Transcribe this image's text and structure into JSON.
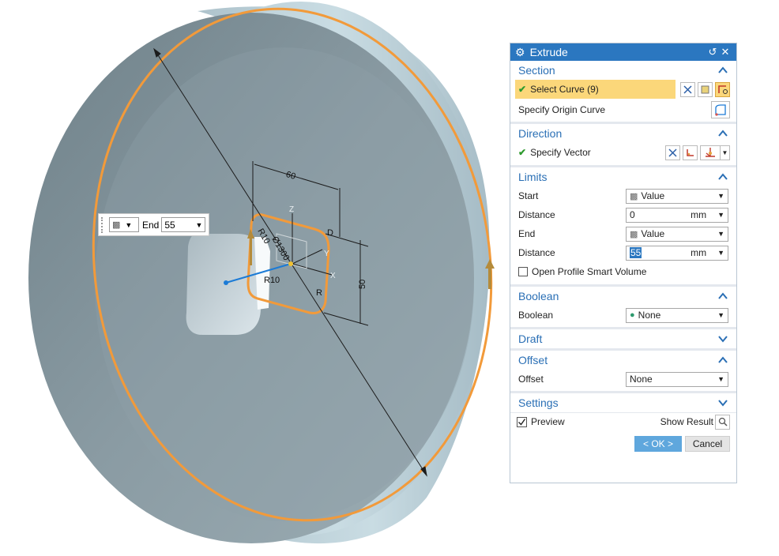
{
  "viewport": {
    "dim_60": "60",
    "dim_50": "50",
    "dim_r10_a": "R10",
    "dim_dia": "Ø1300",
    "dim_r10_b": "R10",
    "dim_r_c": "R",
    "dim_d": "D",
    "axis_z": "Z",
    "axis_y": "Y",
    "axis_x": "X"
  },
  "onscreen": {
    "end_label": "End",
    "end_value": "55"
  },
  "dialog": {
    "title": "Extrude",
    "section": {
      "header": "Section",
      "select_curve": "Select Curve (9)",
      "specify_origin": "Specify Origin Curve"
    },
    "direction": {
      "header": "Direction",
      "specify_vector": "Specify Vector"
    },
    "limits": {
      "header": "Limits",
      "start_label": "Start",
      "start_value": "Value",
      "distance1_label": "Distance",
      "distance1_value": "0",
      "distance1_unit": "mm",
      "end_label": "End",
      "end_value": "Value",
      "distance2_label": "Distance",
      "distance2_value": "55",
      "distance2_unit": "mm",
      "open_profile": "Open Profile Smart Volume"
    },
    "boolean": {
      "header": "Boolean",
      "label": "Boolean",
      "value": "None"
    },
    "draft": {
      "header": "Draft"
    },
    "offset": {
      "header": "Offset",
      "label": "Offset",
      "value": "None"
    },
    "settings": {
      "header": "Settings"
    },
    "preview_label": "Preview",
    "show_result": "Show Result",
    "ok_label": "< OK >",
    "cancel_label": "Cancel"
  },
  "colors": {
    "accent": "#2b77c0",
    "highlight": "#fbd77a",
    "curve": "#f29a3a",
    "face": "#8c9ea6",
    "rim": "#b9cdd6"
  }
}
